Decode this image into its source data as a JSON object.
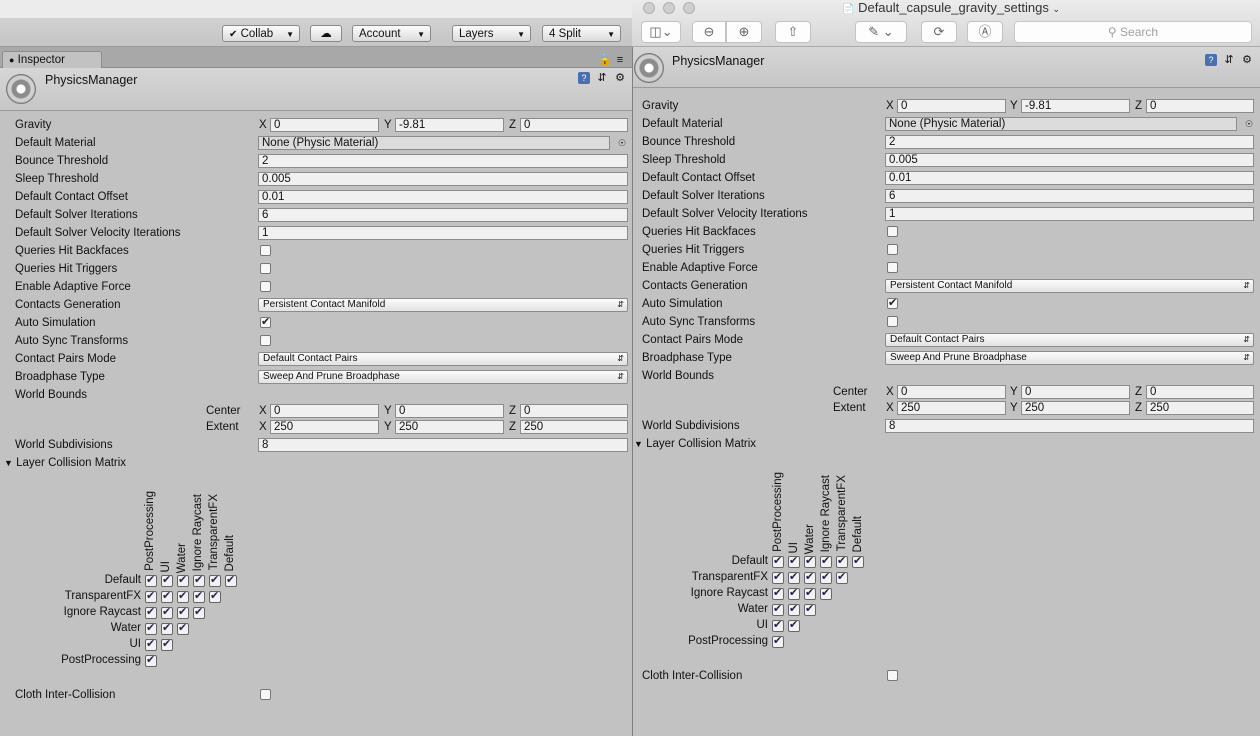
{
  "left": {
    "toolbar": {
      "collab": "Collab",
      "account": "Account",
      "layers": "Layers",
      "layout": "4 Split"
    },
    "tab_label": "Inspector",
    "component_title": "PhysicsManager"
  },
  "right": {
    "window_title": "Default_capsule_gravity_settings",
    "search_placeholder": "Search",
    "component_title": "PhysicsManager"
  },
  "labels": {
    "gravity": "Gravity",
    "default_material": "Default Material",
    "bounce_threshold": "Bounce Threshold",
    "sleep_threshold": "Sleep Threshold",
    "default_contact_offset": "Default Contact Offset",
    "default_solver_iterations": "Default Solver Iterations",
    "default_solver_velocity_iterations": "Default Solver Velocity Iterations",
    "queries_hit_backfaces": "Queries Hit Backfaces",
    "queries_hit_triggers": "Queries Hit Triggers",
    "enable_adaptive_force": "Enable Adaptive Force",
    "contacts_generation": "Contacts Generation",
    "auto_simulation": "Auto Simulation",
    "auto_sync_transforms": "Auto Sync Transforms",
    "contact_pairs_mode": "Contact Pairs Mode",
    "broadphase_type": "Broadphase Type",
    "world_bounds": "World Bounds",
    "center": "Center",
    "extent": "Extent",
    "world_subdivisions": "World Subdivisions",
    "layer_collision_matrix": "Layer Collision Matrix",
    "cloth_inter_collision": "Cloth Inter-Collision",
    "x": "X",
    "y": "Y",
    "z": "Z"
  },
  "values": {
    "gravity": {
      "x": "0",
      "y": "-9.81",
      "z": "0"
    },
    "default_material": "None (Physic Material)",
    "bounce_threshold": "2",
    "sleep_threshold": "0.005",
    "default_contact_offset": "0.01",
    "default_solver_iterations": "6",
    "default_solver_velocity_iterations": "1",
    "queries_hit_backfaces": false,
    "queries_hit_triggers": false,
    "enable_adaptive_force": false,
    "contacts_generation": "Persistent Contact Manifold",
    "auto_simulation": true,
    "auto_sync_transforms": false,
    "contact_pairs_mode": "Default Contact Pairs",
    "broadphase_type": "Sweep And Prune Broadphase",
    "center": {
      "x": "0",
      "y": "0",
      "z": "0"
    },
    "extent": {
      "x": "250",
      "y": "250",
      "z": "250"
    },
    "world_subdivisions": "8",
    "cloth_inter_collision": false
  },
  "layers": [
    "Default",
    "TransparentFX",
    "Ignore Raycast",
    "Water",
    "UI",
    "PostProcessing"
  ],
  "icons": [
    "gear-icon",
    "help-book-icon",
    "preset-sliders-icon",
    "cog-menu-icon",
    "lock-icon",
    "tab-menu-icon",
    "cloud-icon",
    "sidebar-icon",
    "zoom-out-icon",
    "zoom-in-icon",
    "share-icon",
    "markup-pen-icon",
    "rotate-icon",
    "annotate-icon",
    "object-picker-icon"
  ]
}
